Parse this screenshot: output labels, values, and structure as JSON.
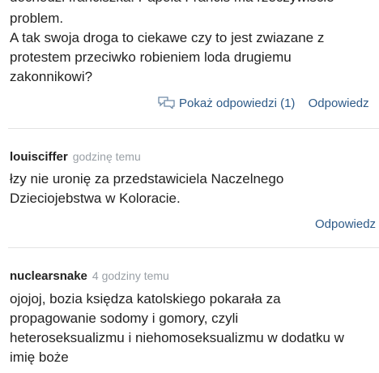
{
  "comments": [
    {
      "cut_line": "docnodzi franciszka. Papoia Francis ma rzeczywiscie",
      "lines": [
        "problem.",
        "A tak swoja droga to ciekawe czy to jest zwiazane z",
        "protestem przeciwko robieniem loda drugiemu",
        "zakonnikowi?"
      ],
      "show_replies_label": "Pokaż odpowiedzi (1)",
      "reply_label": "Odpowiedz"
    },
    {
      "author": "louisciffer",
      "time": "godzinę temu",
      "lines": [
        "łzy nie uronię za przedstawiciela Naczelnego",
        "Dzieciojebstwa w Koloracie."
      ],
      "reply_label": "Odpowiedz"
    },
    {
      "author": "nuclearsnake",
      "time": "4 godziny temu",
      "lines": [
        "ojojoj, bozia księdza katolskiego pokarała za",
        "propagowanie sodomy i gomory, czyli",
        "heteroseksualizmu i niehomoseksualizmu w dodatku w",
        "imię boże"
      ]
    }
  ],
  "colors": {
    "text": "#222222",
    "meta": "#9aa0a6",
    "link": "#2d5a88",
    "divider": "#e3e3e3"
  },
  "icons": {
    "replies": "speech-bubbles-icon"
  }
}
